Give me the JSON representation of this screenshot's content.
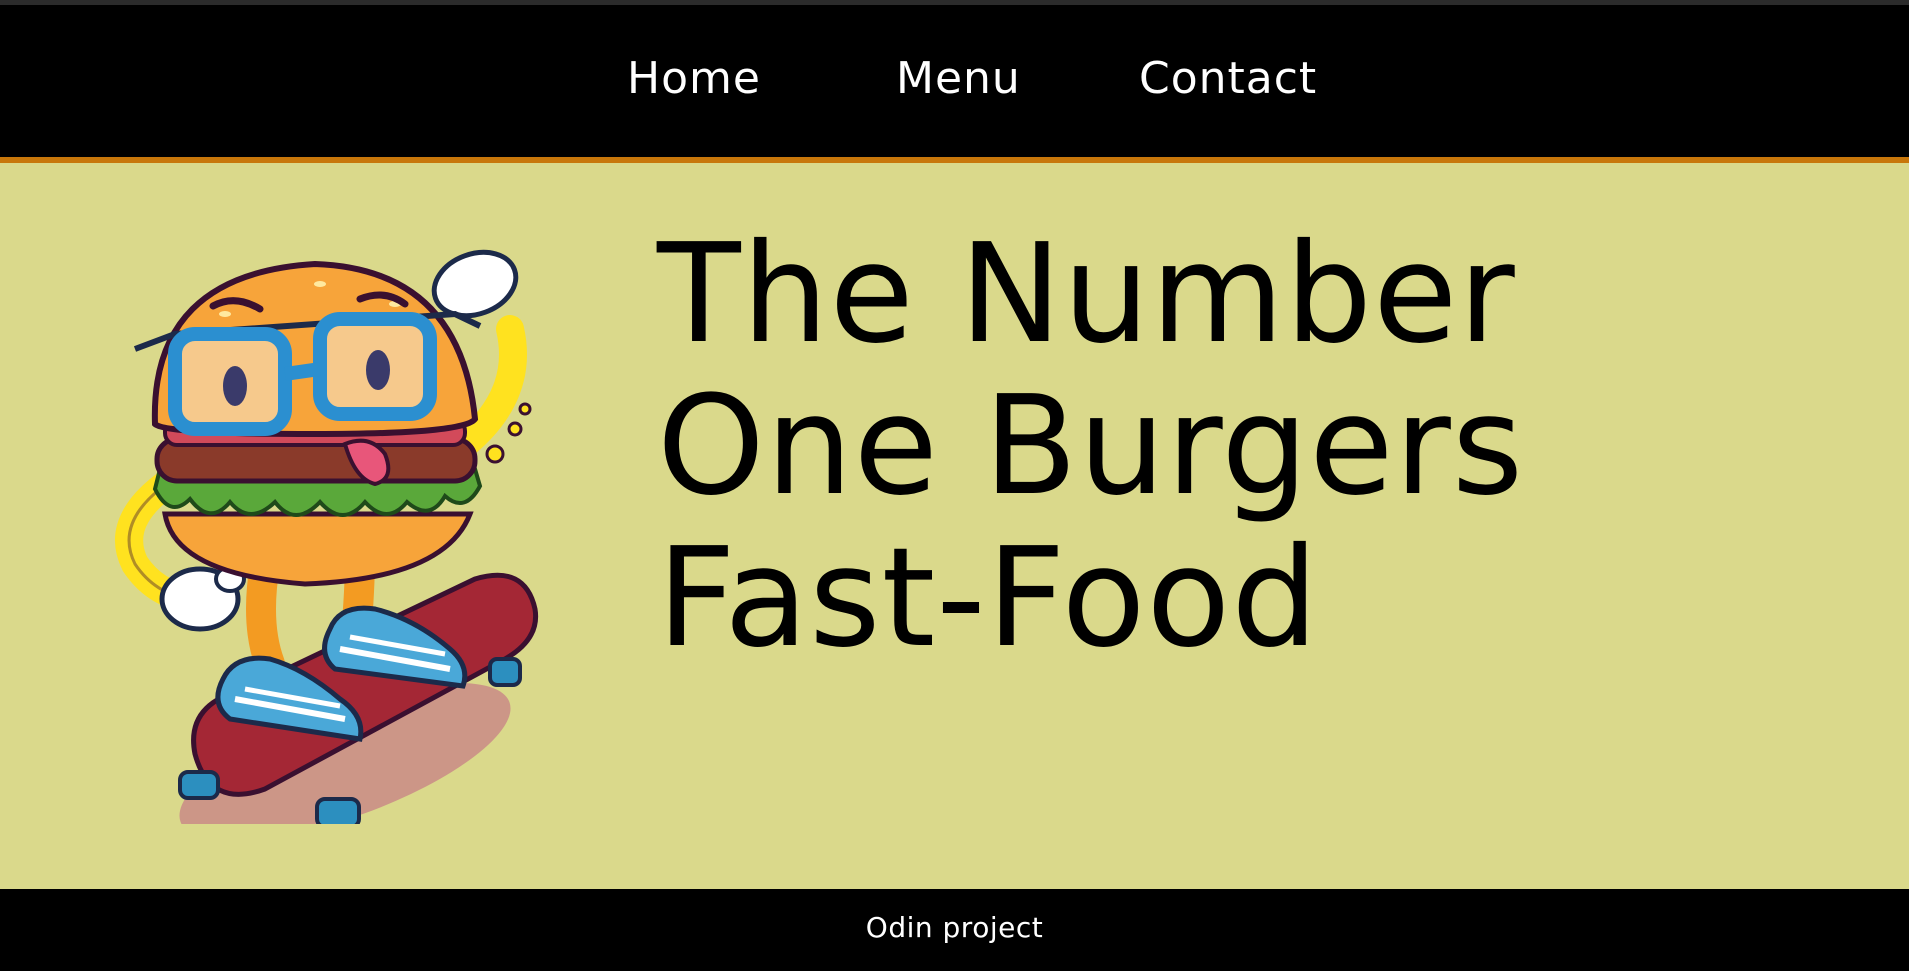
{
  "nav": {
    "items": [
      {
        "label": "Home"
      },
      {
        "label": "Menu"
      },
      {
        "label": "Contact"
      }
    ]
  },
  "hero": {
    "headline_lines": [
      "The Number",
      "One Burgers",
      "Fast-Food"
    ],
    "illustration": "skateboarding-burger-mascot"
  },
  "footer": {
    "text": "Odin project"
  },
  "colors": {
    "nav_bg": "#000000",
    "nav_border": "#c8770a",
    "hero_bg": "#dad98b",
    "text_light": "#ffffff",
    "text_dark": "#000000"
  }
}
